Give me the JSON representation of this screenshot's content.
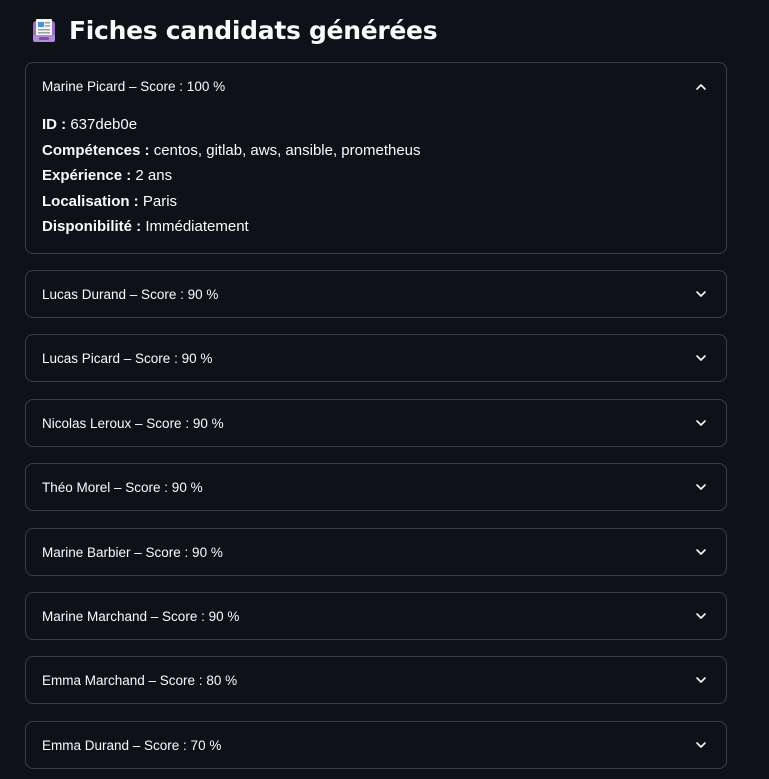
{
  "page": {
    "title": "Fiches candidats générées",
    "title_icon": "clipboard-icon"
  },
  "candidates": [
    {
      "label": "Marine Picard – Score : 100 %",
      "expanded": true,
      "details": {
        "id_label": "ID :",
        "id_value": "637deb0e",
        "skills_label": "Compétences :",
        "skills_value": "centos, gitlab, aws, ansible, prometheus",
        "experience_label": "Expérience :",
        "experience_value": "2 ans",
        "location_label": "Localisation :",
        "location_value": "Paris",
        "availability_label": "Disponibilité :",
        "availability_value": "Immédiatement"
      }
    },
    {
      "label": "Lucas Durand – Score : 90 %",
      "expanded": false
    },
    {
      "label": "Lucas Picard – Score : 90 %",
      "expanded": false
    },
    {
      "label": "Nicolas Leroux – Score : 90 %",
      "expanded": false
    },
    {
      "label": "Théo Morel – Score : 90 %",
      "expanded": false
    },
    {
      "label": "Marine Barbier – Score : 90 %",
      "expanded": false
    },
    {
      "label": "Marine Marchand – Score : 90 %",
      "expanded": false
    },
    {
      "label": "Emma Marchand – Score : 80 %",
      "expanded": false
    },
    {
      "label": "Emma Durand – Score : 70 %",
      "expanded": false
    }
  ],
  "colors": {
    "background": "#0e1117",
    "text": "#fafafa",
    "border": "rgba(250,250,250,0.2)"
  }
}
